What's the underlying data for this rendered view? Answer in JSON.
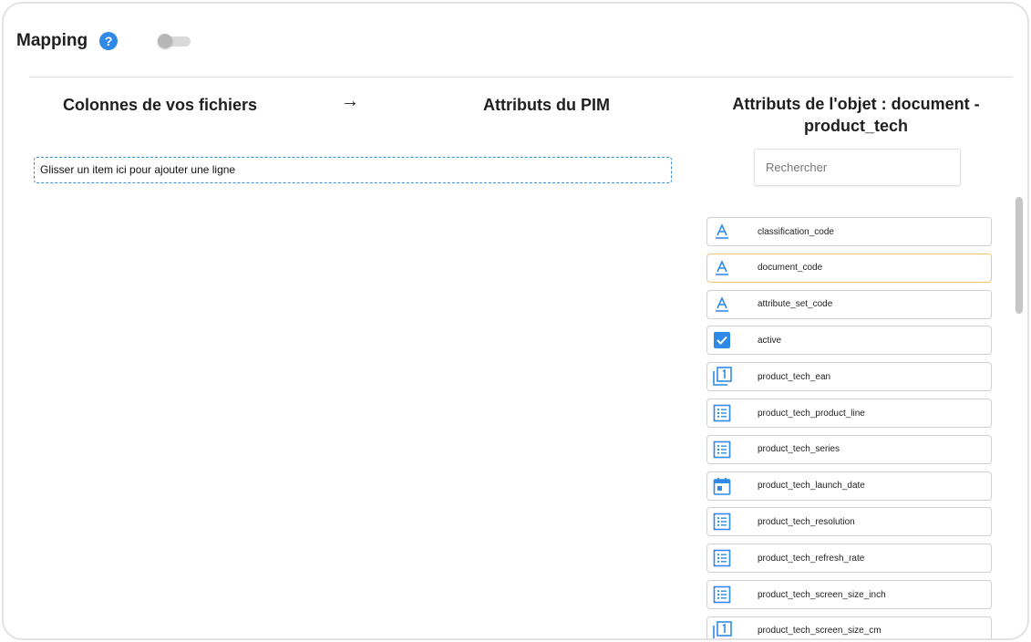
{
  "header": {
    "title": "Mapping",
    "help_icon": "help-circle-icon",
    "toggle_on": false
  },
  "columns": {
    "files_title": "Colonnes de vos fichiers",
    "arrow": "→",
    "pim_title": "Attributs du PIM",
    "object_title": "Attributs de l'objet : document - product_tech"
  },
  "dropzone": {
    "label": "Glisser un item ici pour ajouter une ligne"
  },
  "search": {
    "placeholder": "Rechercher",
    "value": ""
  },
  "attributes": [
    {
      "label": "classification_code",
      "icon": "text-icon",
      "highlighted": false
    },
    {
      "label": "document_code",
      "icon": "text-icon",
      "highlighted": true
    },
    {
      "label": "attribute_set_code",
      "icon": "text-icon",
      "highlighted": false
    },
    {
      "label": "active",
      "icon": "checkbox-icon",
      "highlighted": false
    },
    {
      "label": "product_tech_ean",
      "icon": "identifier-icon",
      "highlighted": false
    },
    {
      "label": "product_tech_product_line",
      "icon": "list-icon",
      "highlighted": false
    },
    {
      "label": "product_tech_series",
      "icon": "list-icon",
      "highlighted": false
    },
    {
      "label": "product_tech_launch_date",
      "icon": "calendar-icon",
      "highlighted": false
    },
    {
      "label": "product_tech_resolution",
      "icon": "list-icon",
      "highlighted": false
    },
    {
      "label": "product_tech_refresh_rate",
      "icon": "list-icon",
      "highlighted": false
    },
    {
      "label": "product_tech_screen_size_inch",
      "icon": "list-icon",
      "highlighted": false
    },
    {
      "label": "product_tech_screen_size_cm",
      "icon": "identifier-icon",
      "highlighted": false
    }
  ],
  "colors": {
    "accent": "#2e8ae6",
    "dropzone_border": "#3a8fd8",
    "highlight_border": "#f0c674"
  }
}
